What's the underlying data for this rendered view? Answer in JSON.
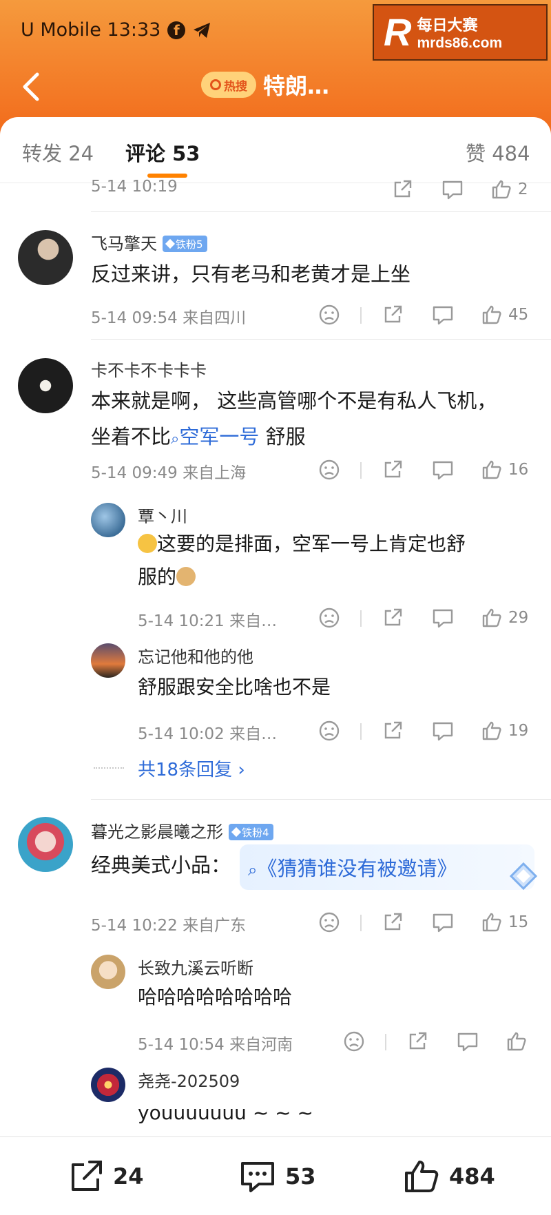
{
  "status_bar": {
    "carrier_time": "U Mobile 13:33",
    "icons": [
      "facebook-icon",
      "telegram-icon"
    ]
  },
  "watermark": {
    "logo_letter": "R",
    "brand_cn": "每日大赛",
    "domain": "mrds86.com"
  },
  "header": {
    "hot_search_badge": "热搜",
    "title": "特朗…"
  },
  "tabs": {
    "repost": "转发 24",
    "comments": "评论 53",
    "likes": "赞 484"
  },
  "top_partial": {
    "date": "5-14 10:19",
    "like_count": "2"
  },
  "comments": [
    {
      "username": "飞马擎天",
      "badge": "铁粉5",
      "text": "反过来讲，只有老马和老黄才是上坐",
      "date_location": "5-14 09:54 来自四川",
      "likes": "45"
    },
    {
      "username": "卡不卡不卡卡卡",
      "text_line1": "本来就是啊， 这些高管哪个不是有私人飞机，",
      "text_pre": "坐着不比",
      "text_link": "空军一号",
      "text_post": " 舒服",
      "date_location": "5-14 09:49 来自上海",
      "likes": "16",
      "replies": [
        {
          "username": "覃丶川",
          "text_line1": "这要的是排面，空军一号上肯定也舒",
          "text_line2": "服的",
          "date_location": "5-14 10:21 来自…",
          "likes": "29"
        },
        {
          "username": "忘记他和他的他",
          "text": "舒服跟安全比啥也不是",
          "date_location": "5-14 10:02 来自…",
          "likes": "19"
        }
      ],
      "more_replies": "共18条回复 ›"
    },
    {
      "username": "暮光之影晨曦之形",
      "badge": "铁粉4",
      "text_pre": "经典美式小品：",
      "topic": "《猜猜谁没有被邀请》",
      "date_location": "5-14 10:22 来自广东",
      "likes": "15",
      "replies": [
        {
          "username": "长致九溪云听断",
          "text": "哈哈哈哈哈哈哈哈",
          "date_location": "5-14 10:54 来自河南",
          "likes": ""
        },
        {
          "username": "尧尧-202509",
          "text": "youuuuuuu ~ ~ ~"
        }
      ]
    }
  ],
  "bottom_bar": {
    "repost_count": "24",
    "comment_count": "53",
    "like_count": "484"
  },
  "colors": {
    "header_top": "#f59a3d",
    "header_bottom": "#f26a1b",
    "accent": "#ff8200",
    "link": "#2e6bd8",
    "badge": "#6ea7f0"
  }
}
